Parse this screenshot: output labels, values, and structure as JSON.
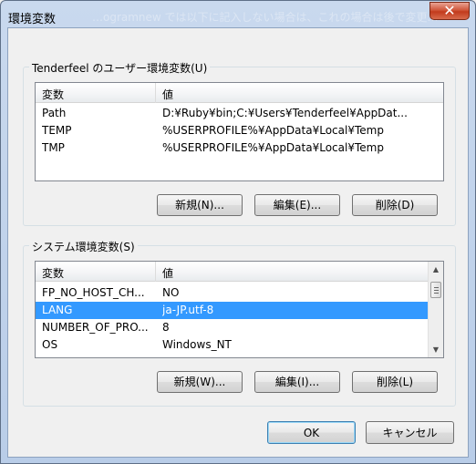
{
  "window": {
    "title": "環境変数",
    "ghost_text": "…ogramnew では以下に記入しない場合は、これの場合は後で変更…",
    "close_symbol": "✕"
  },
  "user_vars": {
    "group_label": "Tenderfeel のユーザー環境変数(U)",
    "columns": [
      "変数",
      "値"
    ],
    "rows": [
      {
        "name": "Path",
        "value": "D:¥Ruby¥bin;C:¥Users¥Tenderfeel¥AppDat..."
      },
      {
        "name": "TEMP",
        "value": "%USERPROFILE%¥AppData¥Local¥Temp"
      },
      {
        "name": "TMP",
        "value": "%USERPROFILE%¥AppData¥Local¥Temp"
      }
    ],
    "buttons": {
      "new": "新規(N)...",
      "edit": "編集(E)...",
      "delete": "削除(D)"
    }
  },
  "system_vars": {
    "group_label": "システム環境変数(S)",
    "columns": [
      "変数",
      "値"
    ],
    "rows": [
      {
        "name": "FP_NO_HOST_CH...",
        "value": "NO"
      },
      {
        "name": "LANG",
        "value": "ja-JP.utf-8"
      },
      {
        "name": "NUMBER_OF_PRO...",
        "value": "8"
      },
      {
        "name": "OS",
        "value": "Windows_NT"
      }
    ],
    "selected_row": 1,
    "buttons": {
      "new": "新規(W)...",
      "edit": "編集(I)...",
      "delete": "削除(L)"
    }
  },
  "dialog_buttons": {
    "ok": "OK",
    "cancel": "キャンセル"
  },
  "colors": {
    "selection": "#3399ff",
    "title_bg": "#c9d9ee",
    "close_button": "#c23b1c"
  }
}
